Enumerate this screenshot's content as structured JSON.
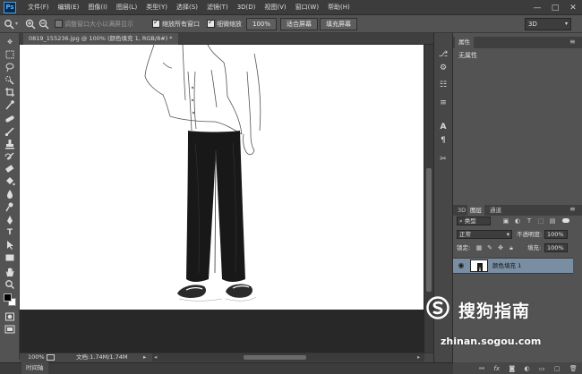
{
  "app": {
    "logo": "Ps"
  },
  "menu": [
    "文件(F)",
    "编辑(E)",
    "图像(I)",
    "图层(L)",
    "类型(Y)",
    "选择(S)",
    "滤镜(T)",
    "3D(D)",
    "视图(V)",
    "窗口(W)",
    "帮助(H)"
  ],
  "window_controls": {
    "minimize": "—",
    "maximize": "□",
    "close": "✕"
  },
  "options_bar": {
    "resize_windows_label": "调整窗口大小以满屏显示",
    "resize_windows_checked": false,
    "zoom_all_label": "缩放所有窗口",
    "zoom_all_checked": true,
    "scrubby_zoom_label": "细微缩放",
    "scrubby_zoom_checked": true,
    "actual_pixels": "100%",
    "fit_screen": "适合屏幕",
    "fill_screen": "填充屏幕",
    "workspace": "3D"
  },
  "document": {
    "tab_title": "0819_155236.jpg @ 100% (颜色填充 1, RGB/8#) *",
    "zoom": "100%",
    "doc_info": "文档:1.74M/1.74M"
  },
  "panels": {
    "properties_tab": "属性",
    "properties_text": "无属性",
    "layer_tabs": [
      "3D",
      "图层",
      "通道"
    ],
    "active_layer_tab": "图层",
    "filter_kind": "类型",
    "blend_mode": "正常",
    "opacity_label": "不透明度:",
    "opacity_value": "100%",
    "lock_label": "锁定:",
    "fill_label": "填充:",
    "fill_value": "100%",
    "layers": [
      {
        "name": "颜色填充 1",
        "visible": true
      }
    ]
  },
  "timeline": {
    "tab": "时间轴"
  },
  "watermark": {
    "chinese": "搜狗指南",
    "url": "zhinan.sogou.com"
  },
  "colors": {
    "foreground": "#000000",
    "background": "#ffffff",
    "layer_highlight": "#7a8ea3"
  }
}
